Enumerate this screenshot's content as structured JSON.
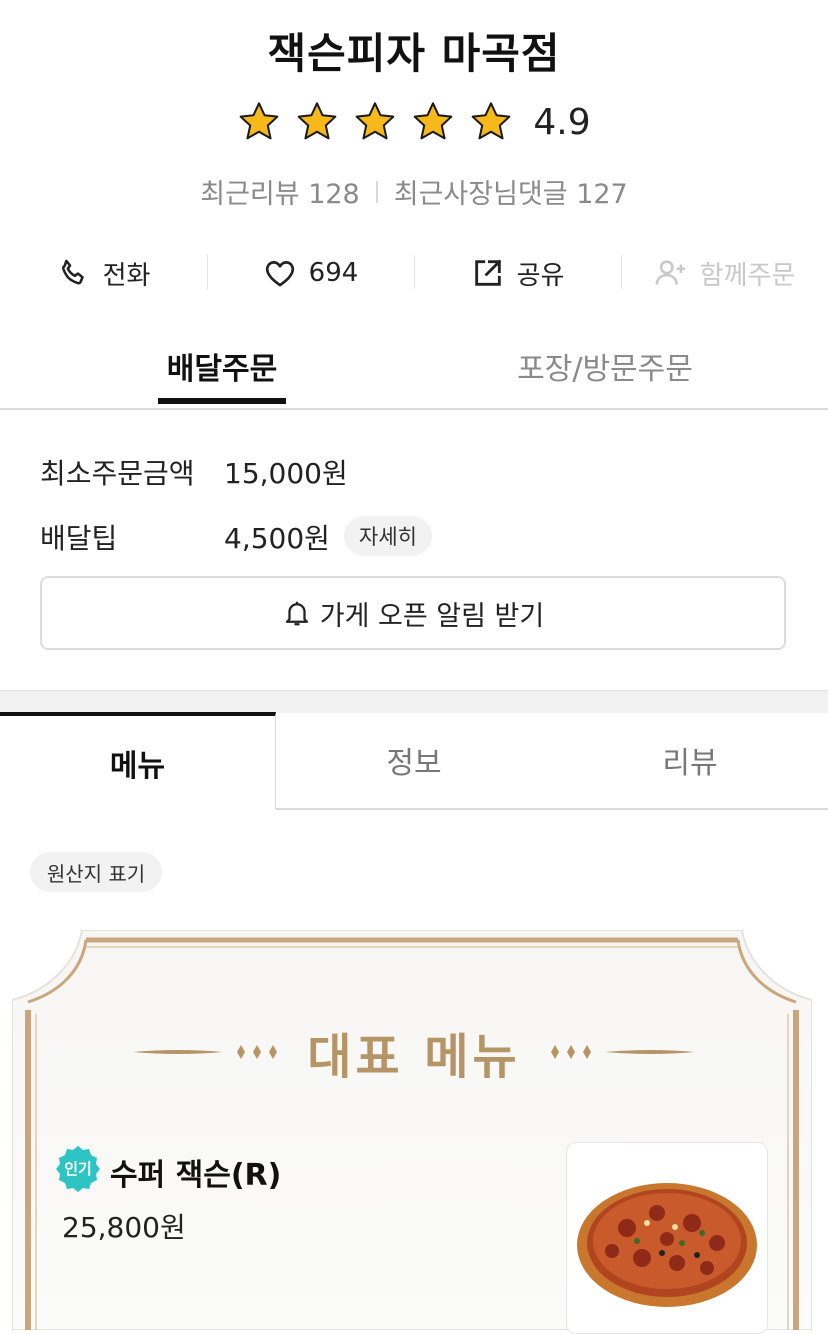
{
  "store": {
    "name": "잭슨피자 마곡점",
    "rating": 4.9,
    "rating_text": "4.9",
    "stars_filled": 5,
    "recent_review_label": "최근리뷰 128",
    "owner_reply_label": "최근사장님댓글 127"
  },
  "actions": {
    "call": {
      "label": "전화",
      "icon": "phone-icon"
    },
    "like": {
      "label": "694",
      "icon": "heart-icon"
    },
    "share": {
      "label": "공유",
      "icon": "share-icon"
    },
    "group_order": {
      "label": "함께주문",
      "icon": "add-user-icon",
      "disabled": true
    }
  },
  "order_tabs": {
    "delivery": "배달주문",
    "pickup": "포장/방문주문",
    "active": "delivery"
  },
  "delivery_info": {
    "min_order_label": "최소주문금액",
    "min_order_value": "15,000원",
    "tip_label": "배달팁",
    "tip_value": "4,500원",
    "detail_button": "자세히",
    "open_alert_button": "가게 오픈 알림 받기"
  },
  "main_tabs": {
    "menu": "메뉴",
    "info": "정보",
    "review": "리뷰",
    "active": "menu"
  },
  "origin_chip": "원산지 표기",
  "featured": {
    "title": "대표 메뉴",
    "items": [
      {
        "badge": "인기",
        "name": "수퍼 잭슨(R)",
        "price": "25,800원"
      }
    ]
  },
  "colors": {
    "accent_gold": "#b59566",
    "badge_teal": "#2ec4c4",
    "star_yellow": "#f6b81a",
    "text_primary": "#111111",
    "text_muted": "#8a8a8a"
  }
}
